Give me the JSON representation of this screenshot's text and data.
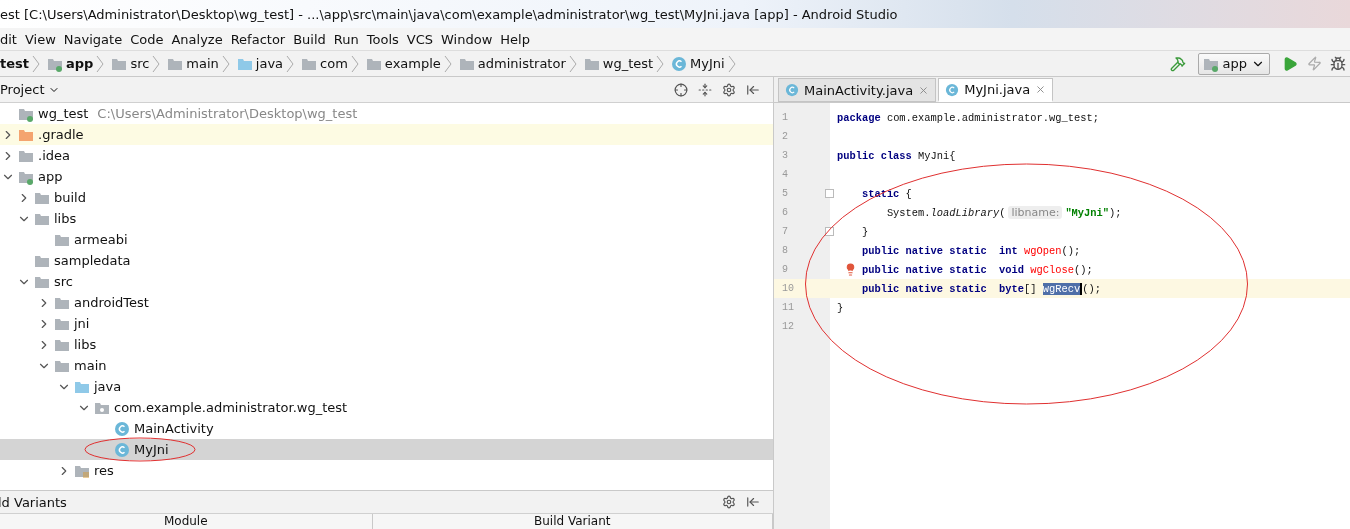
{
  "window": {
    "title": "est [C:\\Users\\Administrator\\Desktop\\wg_test] - ...\\app\\src\\main\\java\\com\\example\\administrator\\wg_test\\MyJni.java [app] - Android Studio"
  },
  "menu": [
    "dit",
    "View",
    "Navigate",
    "Code",
    "Analyze",
    "Refactor",
    "Build",
    "Run",
    "Tools",
    "VCS",
    "Window",
    "Help"
  ],
  "breadcrumbs": [
    {
      "kind": "project",
      "label": "test"
    },
    {
      "kind": "module",
      "label": "app"
    },
    {
      "kind": "folder",
      "label": "src"
    },
    {
      "kind": "folder",
      "label": "main"
    },
    {
      "kind": "source-root",
      "label": "java"
    },
    {
      "kind": "folder",
      "label": "com"
    },
    {
      "kind": "folder",
      "label": "example"
    },
    {
      "kind": "folder",
      "label": "administrator"
    },
    {
      "kind": "folder",
      "label": "wg_test"
    },
    {
      "kind": "class",
      "label": "MyJni"
    }
  ],
  "toolbar": {
    "run_config": "app"
  },
  "project_panel": {
    "title": "Project",
    "tree": [
      {
        "kind": "module",
        "label": "wg_test",
        "path": "C:\\Users\\Administrator\\Desktop\\wg_test",
        "selected": false,
        "children": [
          {
            "kind": "excluded-folder",
            "label": ".gradle",
            "expanded": false,
            "selected": false
          },
          {
            "kind": "folder",
            "label": ".idea",
            "expanded": false,
            "selected": false
          },
          {
            "kind": "module",
            "label": "app",
            "expanded": true,
            "selected": false,
            "children": [
              {
                "kind": "folder",
                "label": "build",
                "expanded": false,
                "selected": false
              },
              {
                "kind": "folder",
                "label": "libs",
                "expanded": true,
                "selected": false,
                "children": [
                  {
                    "kind": "folder",
                    "label": "armeabi",
                    "selected": false
                  }
                ]
              },
              {
                "kind": "folder",
                "label": "sampledata",
                "selected": false
              },
              {
                "kind": "folder",
                "label": "src",
                "expanded": true,
                "selected": false,
                "children": [
                  {
                    "kind": "folder",
                    "label": "androidTest",
                    "expanded": false,
                    "selected": false
                  },
                  {
                    "kind": "folder",
                    "label": "jni",
                    "expanded": false,
                    "selected": false
                  },
                  {
                    "kind": "folder",
                    "label": "libs",
                    "expanded": false,
                    "selected": false
                  },
                  {
                    "kind": "folder",
                    "label": "main",
                    "expanded": true,
                    "selected": false,
                    "children": [
                      {
                        "kind": "source-root",
                        "label": "java",
                        "expanded": true,
                        "selected": false,
                        "children": [
                          {
                            "kind": "package",
                            "label": "com.example.administrator.wg_test",
                            "expanded": true,
                            "selected": false,
                            "children": [
                              {
                                "kind": "class",
                                "label": "MainActivity",
                                "selected": false
                              },
                              {
                                "kind": "class",
                                "label": "MyJni",
                                "selected": true,
                                "circled": true
                              }
                            ]
                          }
                        ]
                      },
                      {
                        "kind": "resources-folder",
                        "label": "res",
                        "expanded": false,
                        "selected": false
                      }
                    ]
                  }
                ]
              }
            ]
          }
        ]
      }
    ]
  },
  "bottom_panel": {
    "title": "ld Variants",
    "columns": [
      "Module",
      "Build Variant"
    ]
  },
  "editor": {
    "circled": true,
    "tabs": [
      {
        "label": "MainActivity.java",
        "selected": false
      },
      {
        "label": "MyJni.java",
        "selected": true
      }
    ],
    "lines": [
      {
        "number": "1",
        "tokens": [
          {
            "kind": "keyword",
            "text": "package"
          },
          {
            "kind": "plain",
            "text": " com.example.administrator.wg_test;"
          }
        ]
      },
      {
        "number": "2"
      },
      {
        "number": "3",
        "tokens": [
          {
            "kind": "keyword",
            "text": "public class"
          },
          {
            "kind": "plain",
            "text": " MyJni{"
          }
        ]
      },
      {
        "number": "4"
      },
      {
        "number": "5",
        "fold": true,
        "tokens": [
          {
            "kind": "keyword",
            "text": "    static"
          },
          {
            "kind": "plain",
            "text": " {"
          }
        ]
      },
      {
        "number": "6",
        "tokens": [
          {
            "kind": "plain",
            "text": "        System."
          },
          {
            "kind": "italic",
            "text": "loadLibrary"
          },
          {
            "kind": "plain",
            "text": "("
          },
          {
            "kind": "hint",
            "text": "libname:"
          },
          {
            "kind": "string",
            "text": "\"MyJni\""
          },
          {
            "kind": "plain",
            "text": ");"
          }
        ]
      },
      {
        "number": "7",
        "fold": true,
        "tokens": [
          {
            "kind": "plain",
            "text": "    }"
          }
        ]
      },
      {
        "number": "8",
        "tokens": [
          {
            "kind": "keyword",
            "text": "    public native static  int"
          },
          {
            "kind": "error",
            "text": " wgOpen"
          },
          {
            "kind": "plain",
            "text": "();"
          }
        ]
      },
      {
        "number": "9",
        "bulb": true,
        "tokens": [
          {
            "kind": "keyword",
            "text": "    public native static  void"
          },
          {
            "kind": "error",
            "text": " wgClose"
          },
          {
            "kind": "plain",
            "text": "();"
          }
        ]
      },
      {
        "number": "10",
        "current": true,
        "tokens": [
          {
            "kind": "keyword",
            "text": "    public native static  byte"
          },
          {
            "kind": "plain",
            "text": "[] "
          },
          {
            "kind": "selected",
            "text": "wgRecv"
          },
          {
            "kind": "plain",
            "text": "();"
          }
        ]
      },
      {
        "number": "11",
        "tokens": [
          {
            "kind": "plain",
            "text": "}"
          }
        ]
      },
      {
        "number": "12"
      }
    ]
  }
}
